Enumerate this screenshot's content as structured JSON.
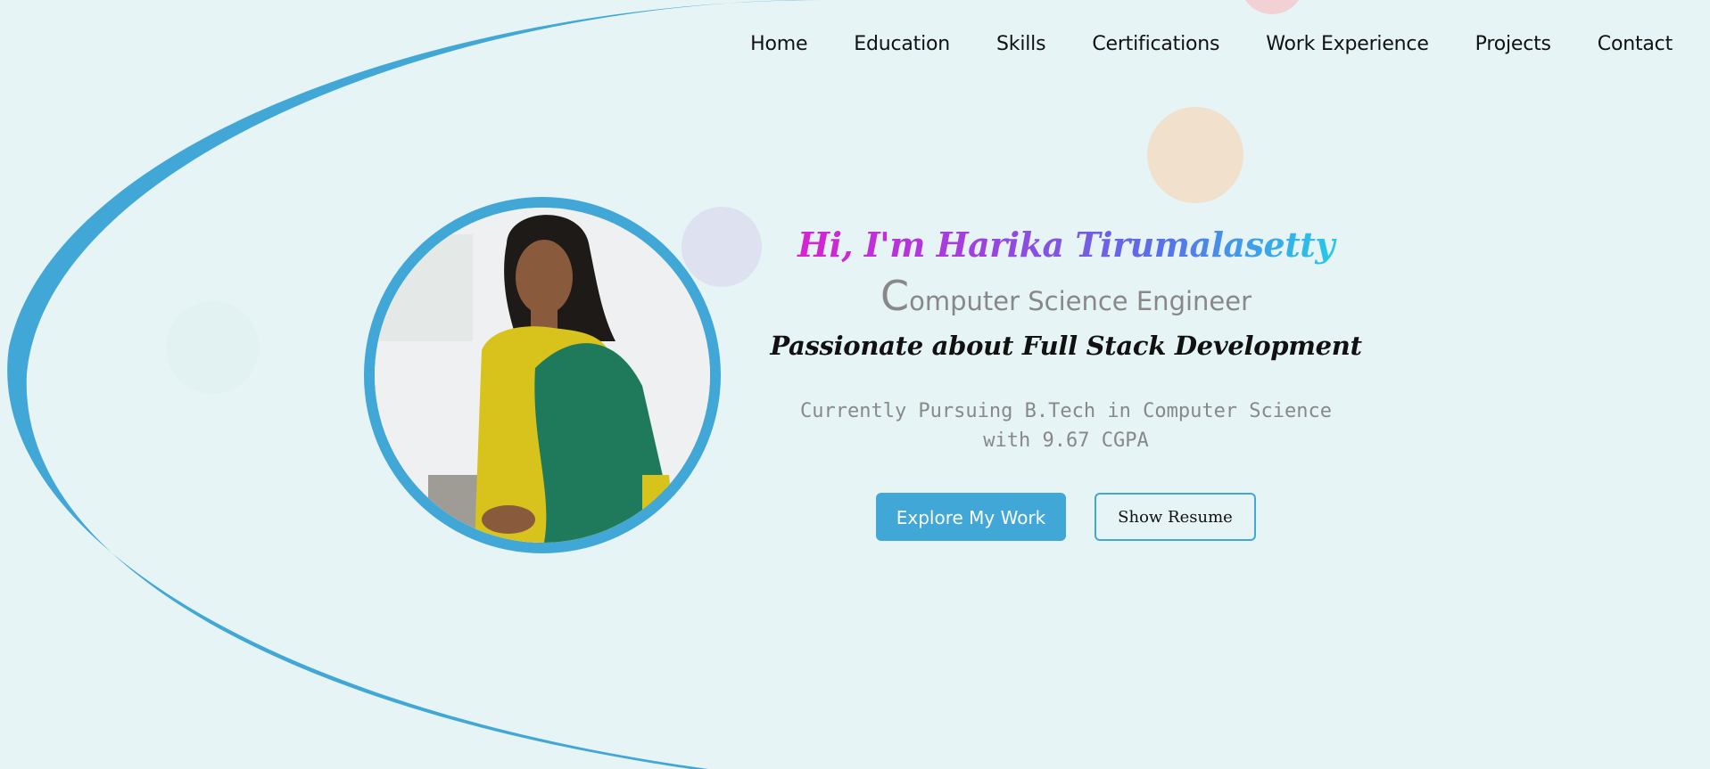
{
  "nav": {
    "items": [
      {
        "label": "Home"
      },
      {
        "label": "Education"
      },
      {
        "label": "Skills"
      },
      {
        "label": "Certifications"
      },
      {
        "label": "Work Experience"
      },
      {
        "label": "Projects"
      },
      {
        "label": "Contact"
      }
    ]
  },
  "hero": {
    "greeting": "Hi, I'm Harika Tirumalasetty",
    "role_initial": "C",
    "role_rest": "omputer Science Engineer",
    "tagline": "Passionate about Full Stack Development",
    "status": "Currently Pursuing B.Tech in Computer Science with 9.67 CGPA",
    "primary_button": "Explore My Work",
    "secondary_button": "Show Resume"
  },
  "colors": {
    "accent": "#40a7d6",
    "background": "#e6f4f6",
    "greeting_gradient": [
      "#e01ed0",
      "#a040e0",
      "#5a6ee8",
      "#1ed8e8"
    ]
  }
}
